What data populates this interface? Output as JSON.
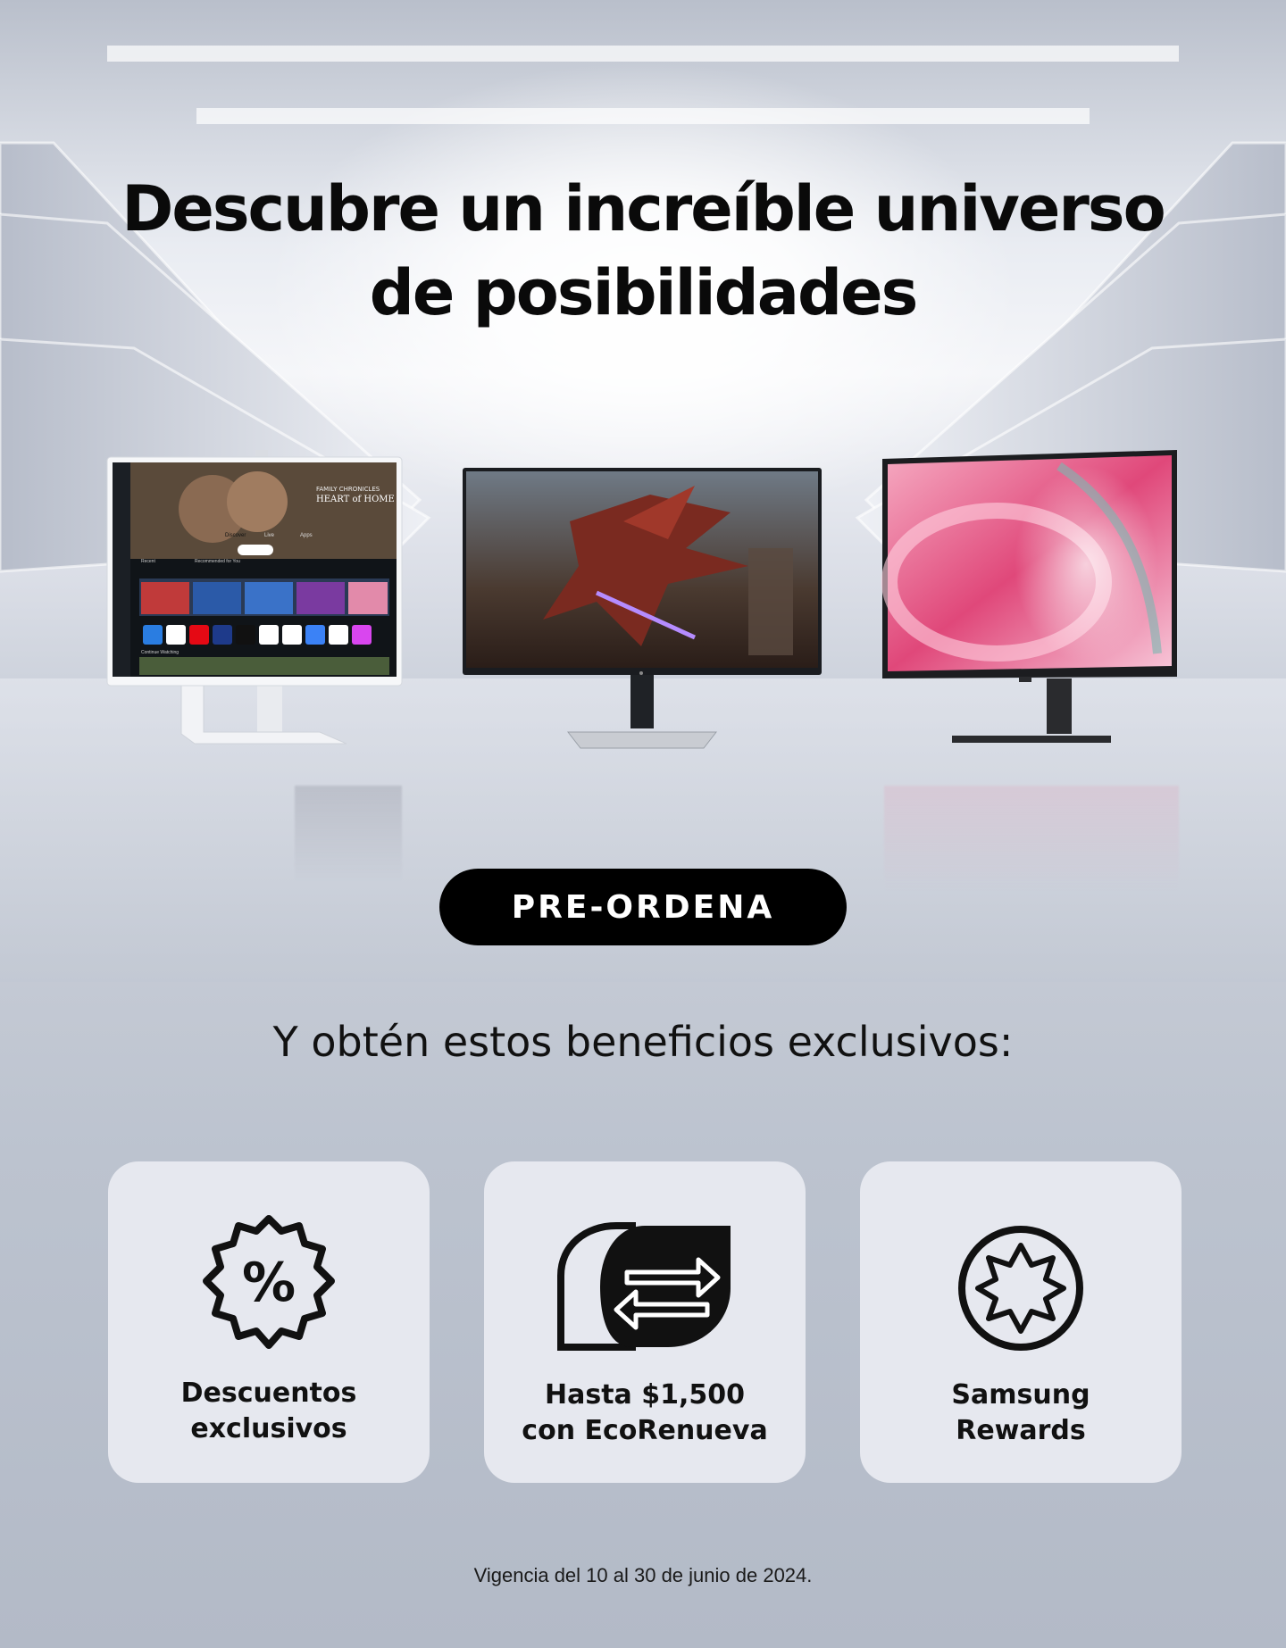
{
  "hero": {
    "headline_line1": "Descubre un increíble universo",
    "headline_line2": "de posibilidades"
  },
  "products": {
    "smart_monitor": {
      "screen_title_line1": "FAMILY CHRONICLES",
      "screen_title_line2": "HEART of HOME",
      "tabs": [
        "Discover",
        "Live",
        "Apps"
      ],
      "row_label_1": "Recent",
      "row_label_2": "Recommended for You",
      "row_label_3": "Continue Watching"
    }
  },
  "cta": {
    "label": "PRE-ORDENA"
  },
  "benefits": {
    "heading": "Y obtén estos beneficios exclusivos:",
    "items": [
      {
        "line1": "Descuentos",
        "line2": "exclusivos",
        "icon": "percent-badge-icon"
      },
      {
        "line1": "Hasta $1,500",
        "line2": "con EcoRenueva",
        "icon": "trade-in-exchange-icon"
      },
      {
        "line1": "Samsung",
        "line2": "Rewards",
        "icon": "star-medal-icon"
      }
    ]
  },
  "footnote": "Vigencia del 10 al 30 de junio de 2024.",
  "colors": {
    "cta_bg": "#000000",
    "card_bg": "#e6e8ef",
    "text": "#0a0a0a"
  }
}
